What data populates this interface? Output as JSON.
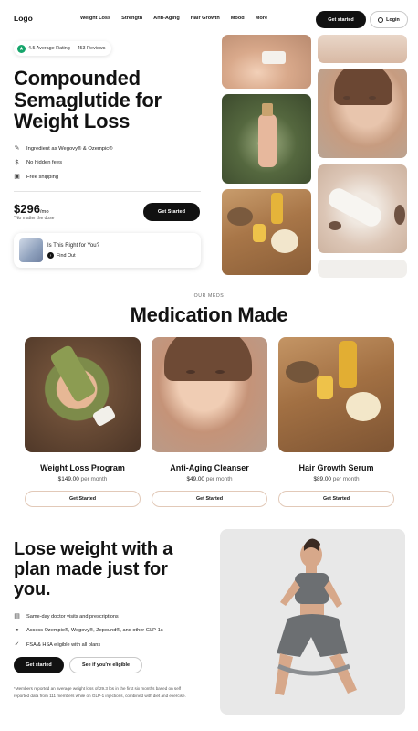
{
  "nav": {
    "logo": "Logo",
    "links": [
      "Weight Loss",
      "Strength",
      "Anti-Aging",
      "Hair Growth",
      "Mood",
      "More"
    ],
    "cta": "Get started",
    "login": "Login"
  },
  "hero": {
    "rating": "4.5 Average Rating",
    "reviews": "453 Reviews",
    "title": "Compounded Semaglutide for Weight Loss",
    "features": [
      "Ingredient as Wegovy® & Ozempic®",
      "No hidden fees",
      "Free shipping"
    ],
    "price": "$296",
    "price_unit": "/mo",
    "price_note": "*No matter the dose",
    "cta": "Get Started",
    "quiz_title": "Is This Right for You?",
    "quiz_link": "Find Out"
  },
  "meds": {
    "eyebrow": "OUR MEDS",
    "title": "Medication Made",
    "items": [
      {
        "name": "Weight Loss Program",
        "price": "$149.00",
        "per": "per month",
        "cta": "Get Started"
      },
      {
        "name": "Anti-Aging Cleanser",
        "price": "$49.00",
        "per": "per month",
        "cta": "Get Started"
      },
      {
        "name": "Hair Growth Serum",
        "price": "$89.00",
        "per": "per month",
        "cta": "Get Started"
      }
    ]
  },
  "plan": {
    "title": "Lose weight with a plan made just for you.",
    "features": [
      "Same-day doctor visits and prescriptions",
      "Access Ozempic®, Wegovy®, Zepound®, and other GLP-1s",
      "FSA & HSA eligible with all plans"
    ],
    "cta_primary": "Get started",
    "cta_secondary": "See if you're eligible",
    "disclaimer": "*Members reported an average weight loss of 29.3 lbs in the first six months based on self reported data from 111 members while on GLP-1 injections, combined with diet and exercise."
  },
  "colors": {
    "accent_dark": "#111111",
    "rating_green": "#16a56b",
    "card_border": "#e2c9b8"
  },
  "icons": [
    "trustpilot-icon",
    "user-icon",
    "pill-icon",
    "dollar-icon",
    "box-icon",
    "arrow-right-icon",
    "calendar-icon",
    "link-icon",
    "check-circle-icon"
  ]
}
